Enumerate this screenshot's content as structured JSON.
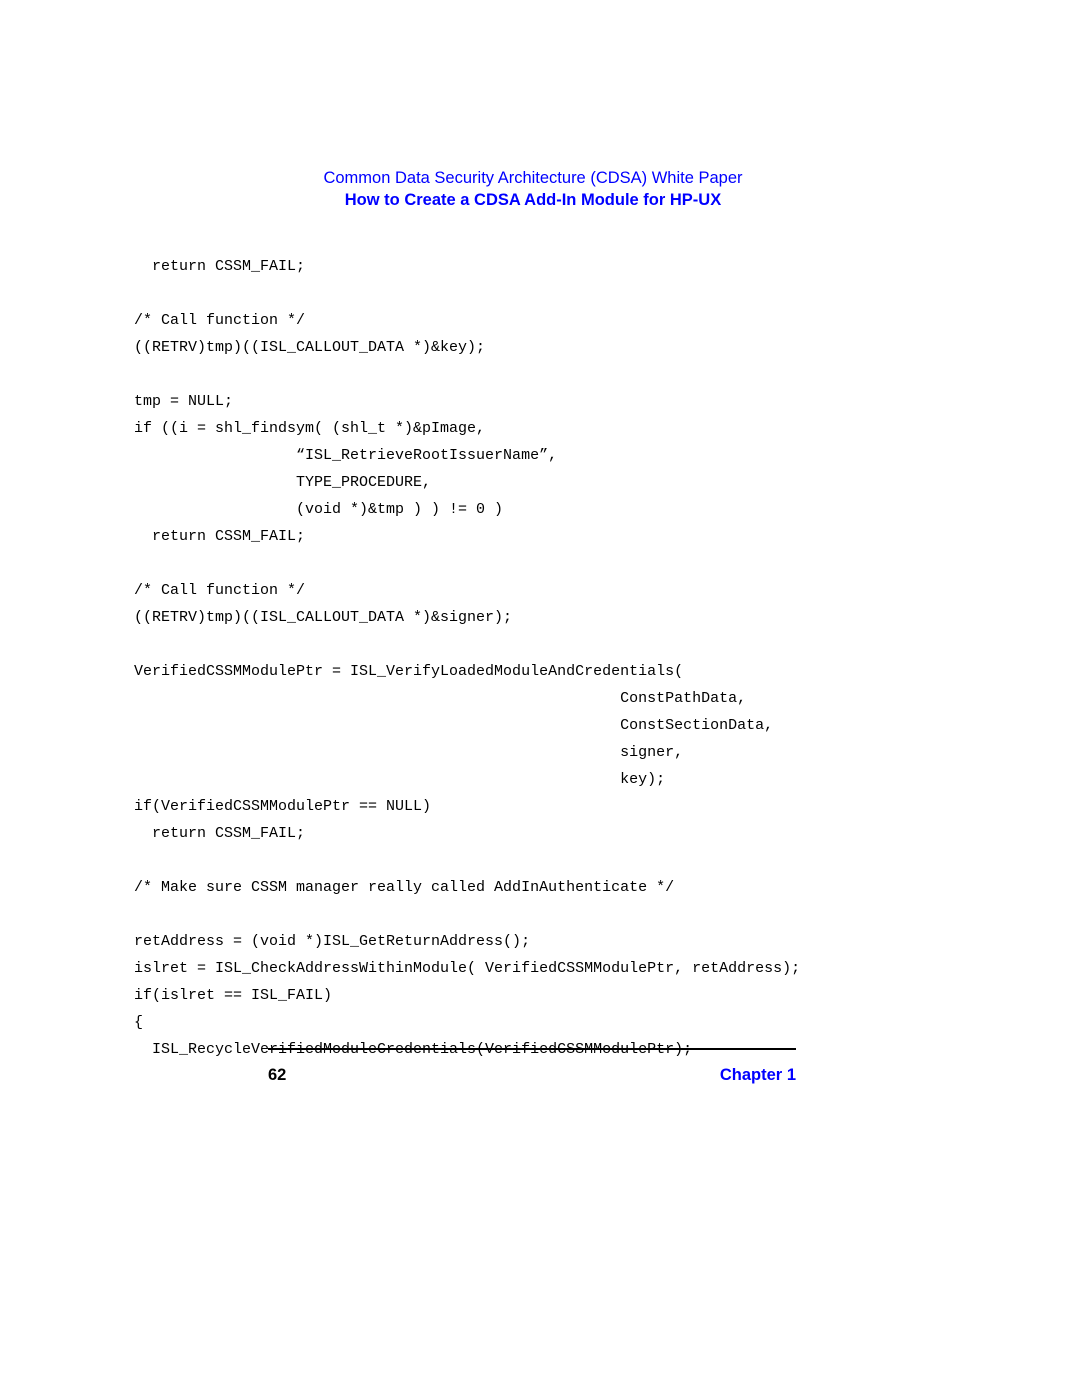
{
  "header": {
    "title": "Common Data Security Architecture (CDSA) White Paper",
    "subtitle": "How to Create a CDSA Add-In Module for HP-UX"
  },
  "code": "  return CSSM_FAIL;\n\n/* Call function */\n((RETRV)tmp)((ISL_CALLOUT_DATA *)&key);\n\ntmp = NULL;\nif ((i = shl_findsym( (shl_t *)&pImage,\n                  “ISL_RetrieveRootIssuerName”,\n                  TYPE_PROCEDURE,\n                  (void *)&tmp ) ) != 0 )\n  return CSSM_FAIL;\n\n/* Call function */\n((RETRV)tmp)((ISL_CALLOUT_DATA *)&signer);\n\nVerifiedCSSMModulePtr = ISL_VerifyLoadedModuleAndCredentials(\n                                                      ConstPathData,\n                                                      ConstSectionData,\n                                                      signer,\n                                                      key);\nif(VerifiedCSSMModulePtr == NULL)\n  return CSSM_FAIL;\n\n/* Make sure CSSM manager really called AddInAuthenticate */\n\nretAddress = (void *)ISL_GetReturnAddress();\nislret = ISL_CheckAddressWithinModule( VerifiedCSSMModulePtr, retAddress);\nif(islret == ISL_FAIL)\n{\n  ISL_RecycleVerifiedModuleCredentials(VerifiedCSSMModulePtr);",
  "footer": {
    "page": "62",
    "chapter": "Chapter 1"
  }
}
